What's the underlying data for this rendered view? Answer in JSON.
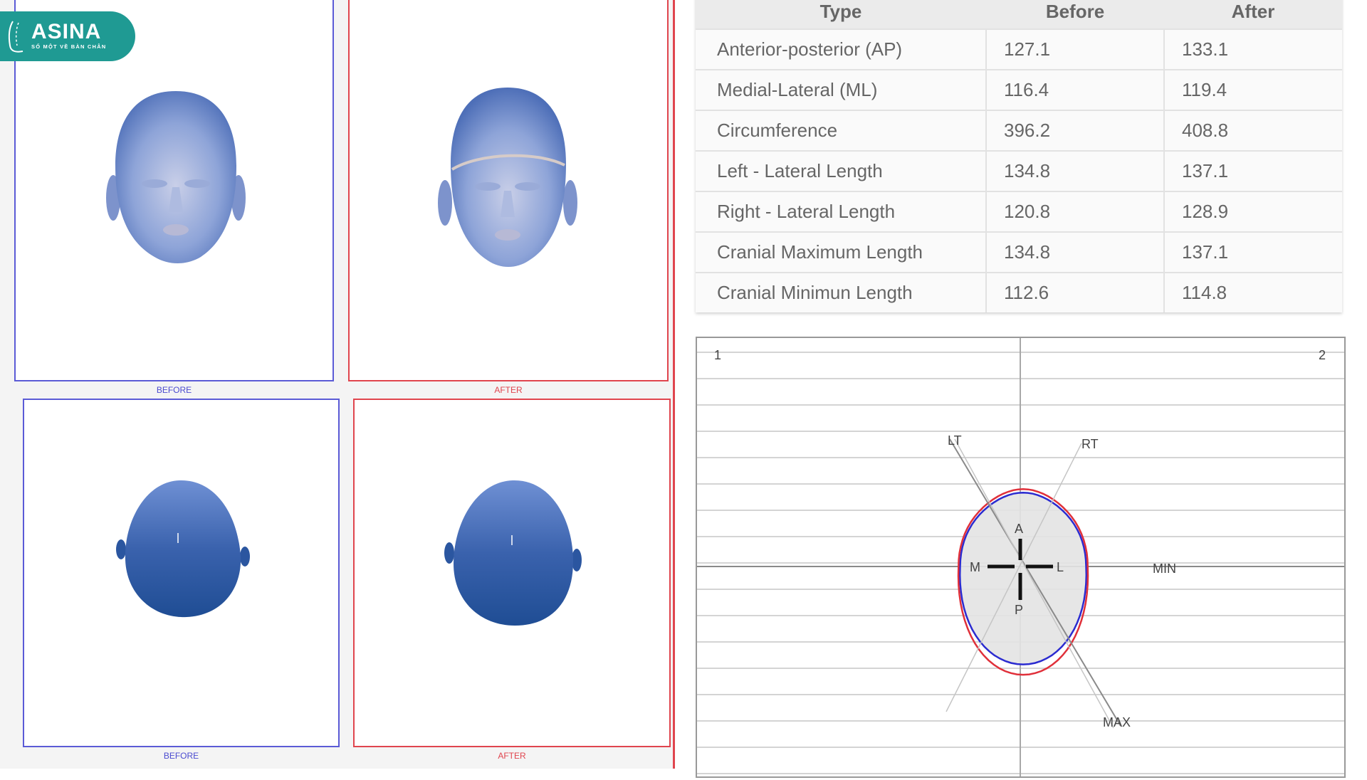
{
  "brand": {
    "name": "ASINA",
    "tagline": "SỐ MỘT VỀ BÀN CHÂN",
    "color": "#1f9a93"
  },
  "views": {
    "front_before_caption": "BEFORE",
    "front_after_caption": "AFTER",
    "top_before_caption": "BEFORE",
    "top_after_caption": "AFTER",
    "before_color": "#5b5bd6",
    "after_color": "#e0454e"
  },
  "table": {
    "headers": [
      "Type",
      "Before",
      "After"
    ],
    "rows": [
      {
        "type": "Anterior-posterior (AP)",
        "before": "127.1",
        "after": "133.1"
      },
      {
        "type": "Medial-Lateral (ML)",
        "before": "116.4",
        "after": "119.4"
      },
      {
        "type": "Circumference",
        "before": "396.2",
        "after": "408.8"
      },
      {
        "type": "Left - Lateral Length",
        "before": "134.8",
        "after": "137.1"
      },
      {
        "type": "Right - Lateral Length",
        "before": "120.8",
        "after": "128.9"
      },
      {
        "type": "Cranial Maximum Length",
        "before": "134.8",
        "after": "137.1"
      },
      {
        "type": "Cranial Minimun Length",
        "before": "112.6",
        "after": "114.8"
      }
    ]
  },
  "chart_data": {
    "type": "line",
    "title": "",
    "quadrant_labels": [
      "1",
      "2"
    ],
    "axis_labels": {
      "anterior": "A",
      "posterior": "P",
      "medial": "M",
      "lateral": "L"
    },
    "diagonal_labels": [
      "LT",
      "RT",
      "MIN",
      "MAX"
    ],
    "grid": true,
    "series": [
      {
        "name": "Before",
        "color": "#2b2bd0",
        "filled": true,
        "fill": "#e3e3e3",
        "outline": {
          "ap": 127.1,
          "ml": 116.4,
          "circumference": 396.2
        }
      },
      {
        "name": "After",
        "color": "#e0303a",
        "filled": false,
        "outline": {
          "ap": 133.1,
          "ml": 119.4,
          "circumference": 408.8
        }
      }
    ]
  }
}
